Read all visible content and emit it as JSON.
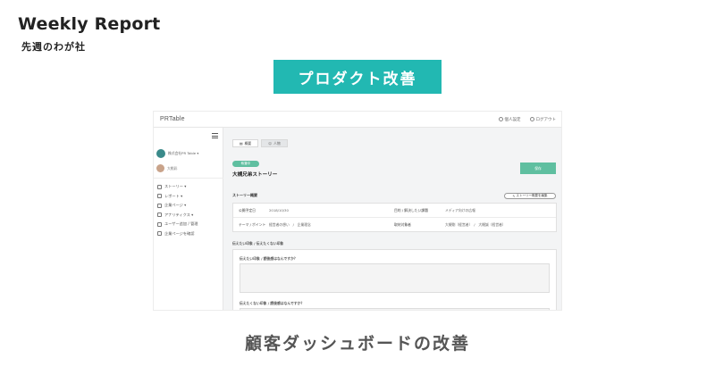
{
  "report": {
    "title": "Weekly Report",
    "subtitle": "先週のわが社"
  },
  "banner": {
    "label": "プロダクト改善"
  },
  "caption": "顧客ダッシュボードの改善",
  "app": {
    "logo": "PRTable",
    "topbar": {
      "personal_settings": "個人設定",
      "logout": "ログアウト"
    },
    "sidebar": {
      "company_name": "株式会社PR Table",
      "user_name": "大桃彩",
      "items": [
        {
          "label": "ストーリー ▾",
          "icon": "edit-icon"
        },
        {
          "label": "レポート ▾",
          "icon": "report-icon"
        },
        {
          "label": "企業ページ ▾",
          "icon": "page-icon"
        },
        {
          "label": "アナリティクス ▾",
          "icon": "analytics-icon"
        },
        {
          "label": "ユーザー追加 / 管理",
          "icon": "user-icon"
        },
        {
          "label": "企業ページを確認",
          "icon": "preview-icon"
        }
      ]
    },
    "tabs": [
      {
        "label": "概要",
        "active": true
      },
      {
        "label": "人物",
        "active": false
      }
    ],
    "status": "執筆中",
    "story_title": "大槻兄弟ストーリー",
    "save_label": "保存",
    "overview": {
      "heading": "ストーリー概要",
      "edit_label": "ストーリー概要を編集",
      "rows": [
        {
          "label1": "公開予定日",
          "value1": "2018/10/30",
          "label2": "目的 / 解決したい課題",
          "value2": "メディア向けの広報"
        },
        {
          "label1": "テーマ / ポイント",
          "value1": "経営者の想い　/　企業理念",
          "label2": "取材対象者",
          "value2": "大槻剛（経営者）　/　大槻誠（経営者）"
        }
      ]
    },
    "impressions": {
      "heading": "伝えたい印象 / 伝えたくない印象",
      "q1": "伝えたい印象 / 読後感はなんですか？",
      "q2": "伝えたくない印象 / 読後感はなんですか？"
    }
  },
  "colors": {
    "banner": "#22b8b2",
    "accent_green": "#5fbfa0"
  }
}
